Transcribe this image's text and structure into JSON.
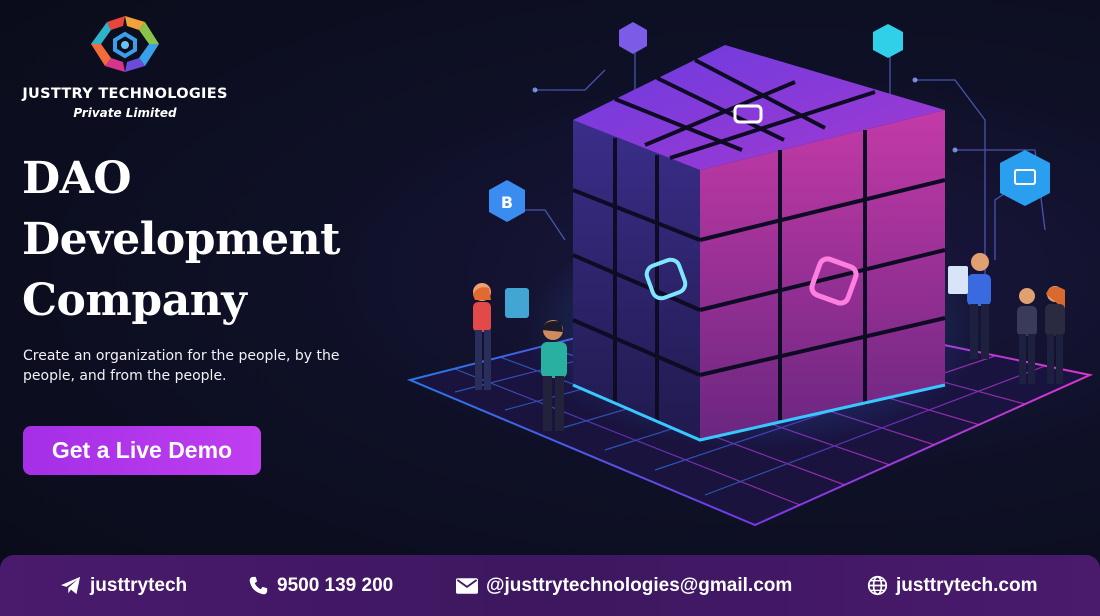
{
  "brand": {
    "name": "JUSTTRY TECHNOLOGIES",
    "subtitle": "Private Limited",
    "logo_icon": "hexagon-logo-icon"
  },
  "hero": {
    "title_lines": [
      "DAO",
      "Development",
      "Company"
    ],
    "subtitle": "Create an organization for the people, by the people, and from the people.",
    "cta_label": "Get a Live Demo"
  },
  "colors": {
    "accent": "#b538ec",
    "footer": "#43195f",
    "background": "#0b0d1c"
  },
  "footer": {
    "telegram": {
      "icon": "telegram-icon",
      "label": "justtrytech"
    },
    "phone": {
      "icon": "phone-icon",
      "label": "9500 139 200"
    },
    "email": {
      "icon": "email-icon",
      "label": "@justtrytechnologies@gmail.com"
    },
    "website": {
      "icon": "globe-icon",
      "label": "justtrytech.com"
    }
  }
}
